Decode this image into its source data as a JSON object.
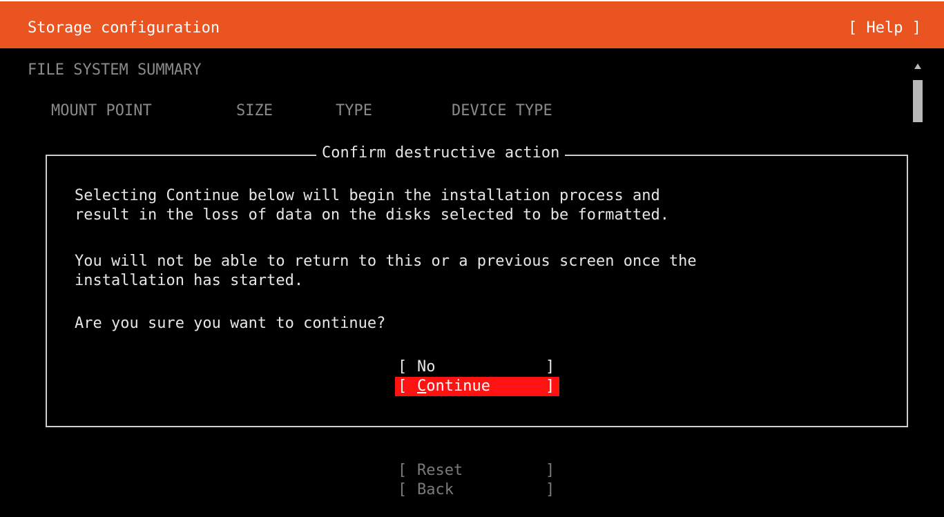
{
  "header": {
    "title": "Storage configuration",
    "help": "[ Help ]"
  },
  "summary": {
    "title": "FILE SYSTEM SUMMARY",
    "columns": [
      "MOUNT POINT",
      "SIZE",
      "TYPE",
      "DEVICE TYPE"
    ]
  },
  "dialog": {
    "title": "Confirm destructive action",
    "paragraph1_line1": "Selecting Continue below will begin the installation process and",
    "paragraph1_line2": "result in the loss of data on the disks selected to be formatted.",
    "paragraph2_line1": "You will not be able to return to this or a previous screen once the",
    "paragraph2_line2": "installation has started.",
    "question": "Are you sure you want to continue?",
    "buttons": {
      "no": {
        "label": "No"
      },
      "continue": {
        "label_first": "C",
        "label_rest": "ontinue"
      }
    }
  },
  "bottom": {
    "reset": "Reset",
    "back": "Back"
  },
  "colors": {
    "header": "#e95420",
    "selected": "#ff1212",
    "background": "#000000"
  },
  "icons": {
    "scroll_up": "scroll-up-arrow-icon"
  }
}
